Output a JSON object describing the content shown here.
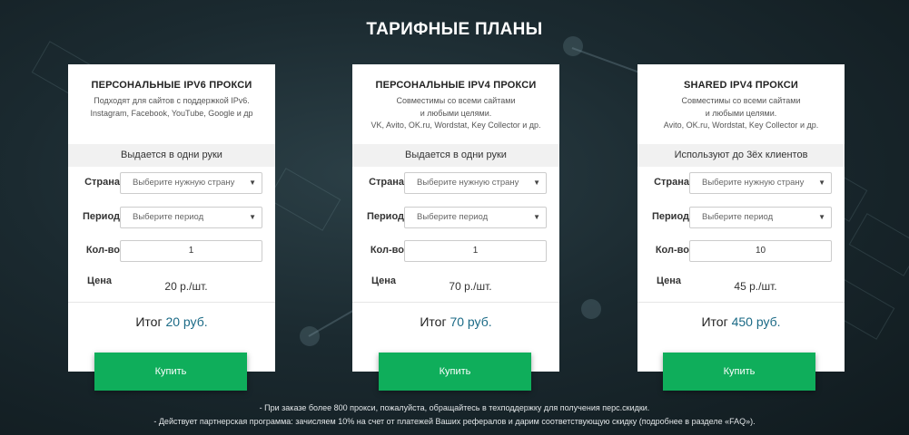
{
  "page": {
    "title": "ТАРИФНЫЕ ПЛАНЫ"
  },
  "labels": {
    "country": "Страна",
    "period": "Период",
    "quantity": "Кол-во",
    "price": "Цена",
    "total": "Итог"
  },
  "plans": [
    {
      "title": "ПЕРСОНАЛЬНЫЕ IPV6 ПРОКСИ",
      "desc_lines": [
        "Подходят для сайтов с поддержкой IPv6.",
        "Instagram, Facebook, YouTube, Google и др"
      ],
      "strip": "Выдается в одни руки",
      "country_placeholder": "Выберите нужную страну",
      "period_placeholder": "Выберите период",
      "quantity": "1",
      "price": "20 р./шт.",
      "total_amount": "20 руб.",
      "buy_label": "Купить"
    },
    {
      "title": "ПЕРСОНАЛЬНЫЕ IPV4 ПРОКСИ",
      "desc_lines": [
        "Совместимы со всеми сайтами",
        "и любыми целями.",
        "VK, Avito, OK.ru, Wordstat, Key Collector и др."
      ],
      "strip": "Выдается в одни руки",
      "country_placeholder": "Выберите нужную страну",
      "period_placeholder": "Выберите период",
      "quantity": "1",
      "price": "70 р./шт.",
      "total_amount": "70 руб.",
      "buy_label": "Купить"
    },
    {
      "title": "SHARED IPV4 ПРОКСИ",
      "desc_lines": [
        "Совместимы со всеми сайтами",
        "и любыми целями.",
        "Avito, OK.ru, Wordstat, Key Collector и др."
      ],
      "strip": "Используют до 3ёх клиентов",
      "country_placeholder": "Выберите нужную страну",
      "period_placeholder": "Выберите период",
      "quantity": "10",
      "price": "45 р./шт.",
      "total_amount": "450 руб.",
      "buy_label": "Купить"
    }
  ],
  "footer": [
    "- При заказе более 800 прокси, пожалуйста, обращайтесь в техподдержку для получения перс.скидки.",
    "- Действует партнерская программа: зачисляем 10% на счет от платежей Ваших рефералов и дарим соответствующую скидку (подробнее в разделе «FAQ»)."
  ],
  "icons": {
    "dropdown": "chevron-down-icon"
  },
  "colors": {
    "accent_green": "#0fae5b",
    "sum_blue": "#1b6a86"
  }
}
